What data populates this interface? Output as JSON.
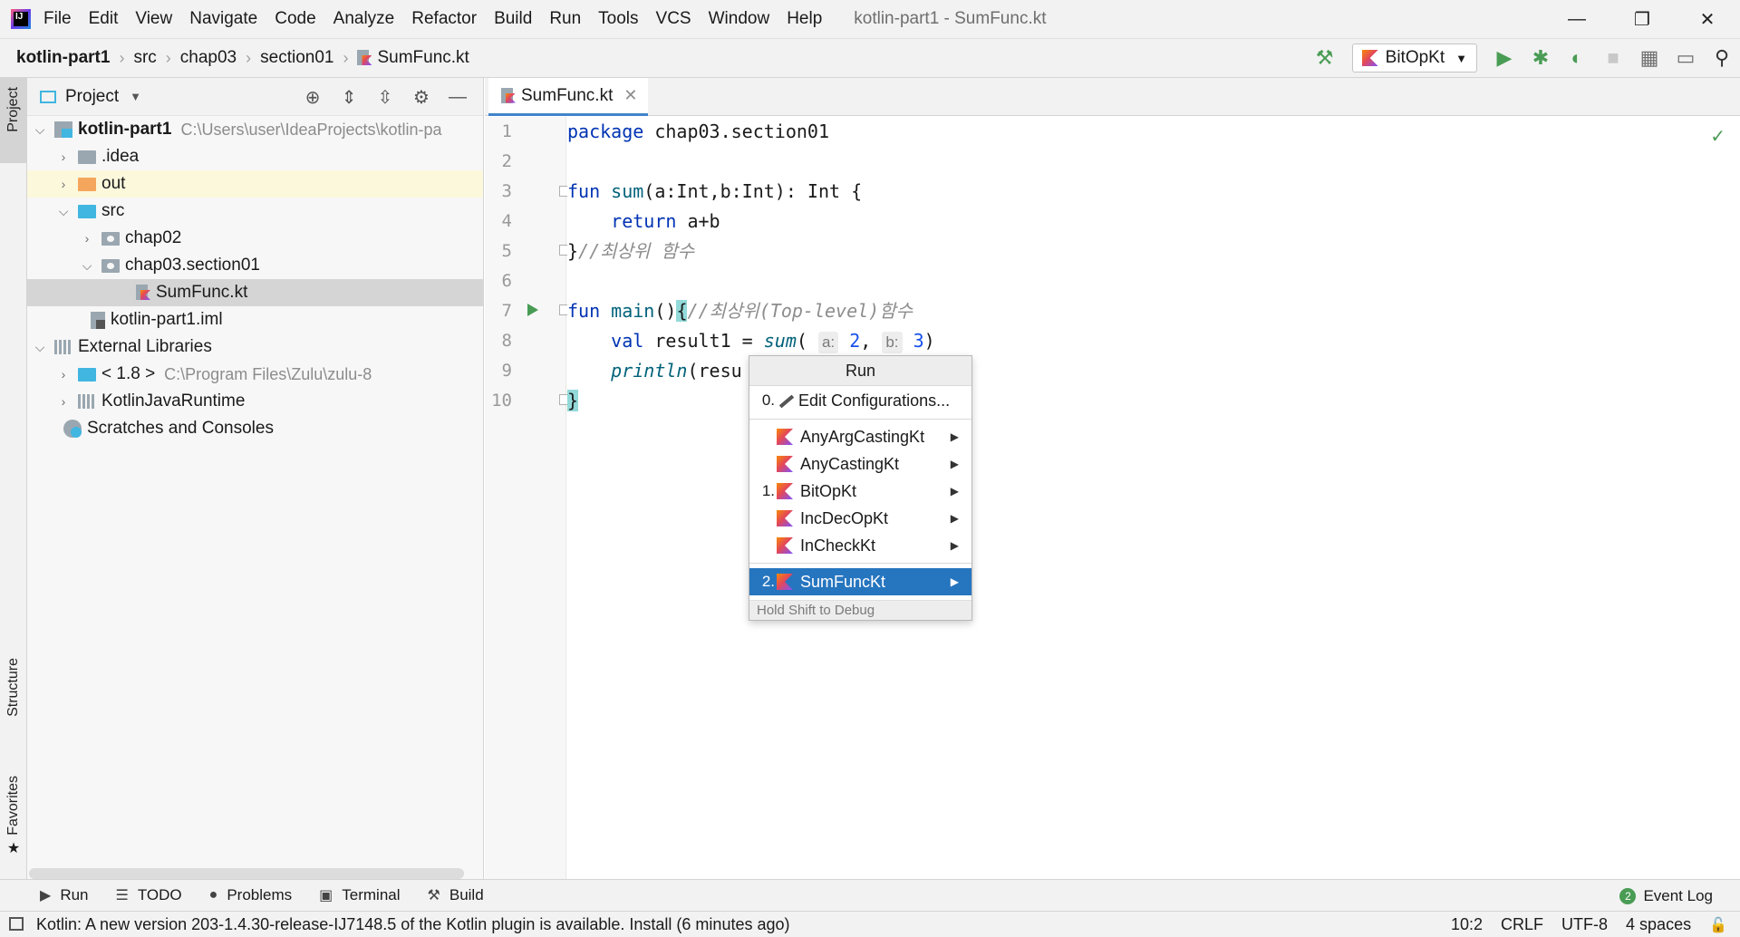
{
  "menubar": {
    "app_logo_text": "IJ",
    "items": [
      "File",
      "Edit",
      "View",
      "Navigate",
      "Code",
      "Analyze",
      "Refactor",
      "Build",
      "Run",
      "Tools",
      "VCS",
      "Window",
      "Help"
    ],
    "window_title": "kotlin-part1 - SumFunc.kt",
    "minimize": "—",
    "restore": "❐",
    "close": "✕"
  },
  "breadcrumb": [
    "kotlin-part1",
    "src",
    "chap03",
    "section01",
    "SumFunc.kt"
  ],
  "toolbar": {
    "run_config": "BitOpKt",
    "icons": [
      "hammer-icon",
      "run-icon",
      "debug-icon",
      "coverage-icon",
      "stop-icon",
      "project-structure-icon",
      "show-panel-icon",
      "search-icon"
    ]
  },
  "left_strip": {
    "project": "Project",
    "structure": "Structure",
    "favorites": "Favorites"
  },
  "project_panel": {
    "title": "Project",
    "tree": [
      {
        "label": "kotlin-part1",
        "hint": "C:\\Users\\user\\IdeaProjects\\kotlin-pa"
      },
      {
        "label": ".idea"
      },
      {
        "label": "out"
      },
      {
        "label": "src"
      },
      {
        "label": "chap02"
      },
      {
        "label": "chap03.section01"
      },
      {
        "label": "SumFunc.kt"
      },
      {
        "label": "kotlin-part1.iml"
      },
      {
        "label": "External Libraries"
      },
      {
        "label": "< 1.8 >",
        "hint": "C:\\Program Files\\Zulu\\zulu-8"
      },
      {
        "label": "KotlinJavaRuntime"
      },
      {
        "label": "Scratches and Consoles"
      }
    ]
  },
  "editor": {
    "tab": "SumFunc.kt",
    "line_numbers": [
      "1",
      "2",
      "3",
      "4",
      "5",
      "6",
      "7",
      "8",
      "9",
      "10"
    ],
    "code": {
      "l1_kw": "package",
      "l1_rest": " chap03.section01",
      "l3_kw": "fun",
      "l3_fn": "sum",
      "l3_rest": "(a:Int,b:Int): Int {",
      "l4_kw": "return",
      "l4_rest": " a+b",
      "l5_brace": "}",
      "l5_comment": "//최상위 함수",
      "l7_kw": "fun",
      "l7_fn": "main",
      "l7_parens": "()",
      "l7_brace": "{",
      "l7_comment": "//최상위(Top-level)함수",
      "l8_kw": "val",
      "l8_mid": " result1 = ",
      "l8_fn": "sum",
      "l8_open": "(",
      "l8_hint_a": "a:",
      "l8_num_a": "2",
      "l8_comma": ", ",
      "l8_hint_b": "b:",
      "l8_num_b": "3",
      "l8_close": ")",
      "l9_fn": "println",
      "l9_rest": "(resu",
      "l10_brace": "}"
    }
  },
  "run_popup": {
    "title": "Run",
    "edit_config": {
      "mnemonic": "0.",
      "label": "Edit Configurations..."
    },
    "items": [
      {
        "mnemonic": "",
        "label": "AnyArgCastingKt"
      },
      {
        "mnemonic": "",
        "label": "AnyCastingKt"
      },
      {
        "mnemonic": "1.",
        "label": "BitOpKt"
      },
      {
        "mnemonic": "",
        "label": "IncDecOpKt"
      },
      {
        "mnemonic": "",
        "label": "InCheckKt"
      },
      {
        "mnemonic": "2.",
        "label": "SumFuncKt"
      }
    ],
    "footer": "Hold Shift to Debug"
  },
  "bottom_tools": [
    "Run",
    "TODO",
    "Problems",
    "Terminal",
    "Build"
  ],
  "event_log": {
    "count": "2",
    "label": "Event Log"
  },
  "statusbar": {
    "message": "Kotlin: A new version 203-1.4.30-release-IJ7148.5 of the Kotlin plugin is available. Install (6 minutes ago)",
    "position": "10:2",
    "line_sep": "CRLF",
    "encoding": "UTF-8",
    "indent": "4 spaces"
  },
  "colors": {
    "accent": "#2675bf",
    "keyword": "#0033b3",
    "function": "#00627a",
    "comment": "#8c8c8c",
    "number": "#1750eb",
    "run_green": "#499c54"
  }
}
